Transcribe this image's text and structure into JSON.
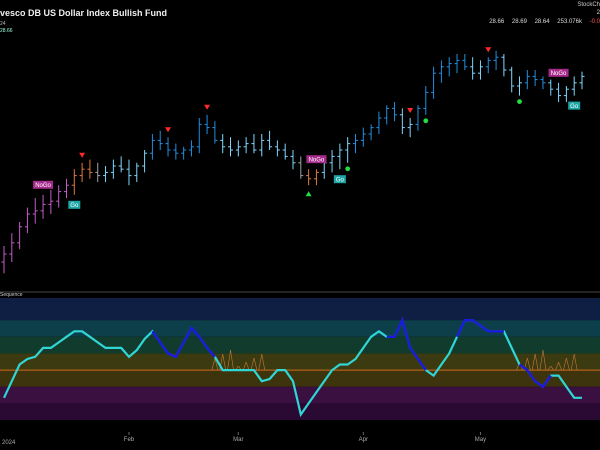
{
  "header": {
    "title": "vesco DB US Dollar Index Bullish Fund",
    "subtitle": "24",
    "last_price": "28.66",
    "brand": "StockCh",
    "year_tag": "2",
    "ohlc": [
      "28.66",
      "28.69",
      "28.64",
      "253.076k",
      "-0.0"
    ]
  },
  "oscillator_label": "Sequence",
  "year_label": "2024",
  "colors": {
    "background": "#000000",
    "go_strong": "#1f8fe0",
    "go_weak": "#7fd7ff",
    "nogo_weak": "#e07a3c",
    "nogo_strong": "#c35bc8",
    "neutral": "#9ea3a8",
    "osc_line_up": "#30d6d6",
    "osc_line_strong": "#1a1adc",
    "zero_line": "#d2691e",
    "go_label_bg": "#1ea5a5",
    "nogo_label_bg": "#a52a8c",
    "signal_green": "#22dd44",
    "signal_red": "#ff2a2a"
  },
  "chart_data": [
    {
      "type": "candlestick",
      "title": "vesco DB US Dollar Index Bullish Fund",
      "x_ticks": [
        "Feb",
        "Mar",
        "Apr",
        "May"
      ],
      "ylim": [
        27.35,
        28.95
      ],
      "bars": [
        {
          "o": 27.5,
          "h": 27.6,
          "l": 27.43,
          "c": 27.55,
          "s": "nogo_strong"
        },
        {
          "o": 27.55,
          "h": 27.68,
          "l": 27.5,
          "c": 27.62,
          "s": "nogo_strong"
        },
        {
          "o": 27.62,
          "h": 27.75,
          "l": 27.58,
          "c": 27.72,
          "s": "nogo_strong"
        },
        {
          "o": 27.72,
          "h": 27.84,
          "l": 27.68,
          "c": 27.8,
          "s": "nogo_strong"
        },
        {
          "o": 27.8,
          "h": 27.9,
          "l": 27.74,
          "c": 27.82,
          "s": "nogo_strong"
        },
        {
          "o": 27.82,
          "h": 27.92,
          "l": 27.77,
          "c": 27.86,
          "s": "nogo_strong"
        },
        {
          "o": 27.86,
          "h": 27.95,
          "l": 27.8,
          "c": 27.88,
          "s": "nogo_strong"
        },
        {
          "o": 27.88,
          "h": 27.98,
          "l": 27.84,
          "c": 27.94,
          "s": "nogo_strong"
        },
        {
          "o": 27.94,
          "h": 28.02,
          "l": 27.9,
          "c": 27.98,
          "s": "nogo_strong"
        },
        {
          "o": 27.98,
          "h": 28.08,
          "l": 27.92,
          "c": 28.04,
          "s": "nogo_weak"
        },
        {
          "o": 28.04,
          "h": 28.12,
          "l": 28.0,
          "c": 28.08,
          "s": "nogo_weak"
        },
        {
          "o": 28.08,
          "h": 28.14,
          "l": 28.02,
          "c": 28.06,
          "s": "nogo_weak"
        },
        {
          "o": 28.06,
          "h": 28.12,
          "l": 28.0,
          "c": 28.04,
          "s": "neutral"
        },
        {
          "o": 28.04,
          "h": 28.1,
          "l": 28.0,
          "c": 28.06,
          "s": "go_weak"
        },
        {
          "o": 28.06,
          "h": 28.14,
          "l": 28.02,
          "c": 28.1,
          "s": "go_weak"
        },
        {
          "o": 28.1,
          "h": 28.16,
          "l": 28.06,
          "c": 28.08,
          "s": "go_weak"
        },
        {
          "o": 28.08,
          "h": 28.14,
          "l": 27.98,
          "c": 28.04,
          "s": "go_weak"
        },
        {
          "o": 28.04,
          "h": 28.12,
          "l": 28.0,
          "c": 28.1,
          "s": "go_weak"
        },
        {
          "o": 28.1,
          "h": 28.2,
          "l": 28.06,
          "c": 28.18,
          "s": "go_weak"
        },
        {
          "o": 28.18,
          "h": 28.3,
          "l": 28.14,
          "c": 28.26,
          "s": "go_strong"
        },
        {
          "o": 28.26,
          "h": 28.32,
          "l": 28.2,
          "c": 28.24,
          "s": "go_strong"
        },
        {
          "o": 28.24,
          "h": 28.28,
          "l": 28.16,
          "c": 28.2,
          "s": "go_strong"
        },
        {
          "o": 28.2,
          "h": 28.24,
          "l": 28.14,
          "c": 28.18,
          "s": "go_strong"
        },
        {
          "o": 28.18,
          "h": 28.22,
          "l": 28.14,
          "c": 28.2,
          "s": "go_strong"
        },
        {
          "o": 28.2,
          "h": 28.26,
          "l": 28.16,
          "c": 28.22,
          "s": "go_strong"
        },
        {
          "o": 28.22,
          "h": 28.4,
          "l": 28.18,
          "c": 28.36,
          "s": "go_strong"
        },
        {
          "o": 28.36,
          "h": 28.42,
          "l": 28.3,
          "c": 28.34,
          "s": "go_strong"
        },
        {
          "o": 28.34,
          "h": 28.38,
          "l": 28.24,
          "c": 28.26,
          "s": "go_strong"
        },
        {
          "o": 28.26,
          "h": 28.3,
          "l": 28.18,
          "c": 28.22,
          "s": "go_weak"
        },
        {
          "o": 28.22,
          "h": 28.28,
          "l": 28.16,
          "c": 28.2,
          "s": "go_weak"
        },
        {
          "o": 28.2,
          "h": 28.26,
          "l": 28.16,
          "c": 28.22,
          "s": "go_weak"
        },
        {
          "o": 28.22,
          "h": 28.28,
          "l": 28.18,
          "c": 28.24,
          "s": "go_weak"
        },
        {
          "o": 28.24,
          "h": 28.3,
          "l": 28.18,
          "c": 28.2,
          "s": "go_weak"
        },
        {
          "o": 28.2,
          "h": 28.3,
          "l": 28.16,
          "c": 28.26,
          "s": "go_weak"
        },
        {
          "o": 28.26,
          "h": 28.32,
          "l": 28.2,
          "c": 28.22,
          "s": "go_weak"
        },
        {
          "o": 28.22,
          "h": 28.26,
          "l": 28.16,
          "c": 28.2,
          "s": "go_weak"
        },
        {
          "o": 28.2,
          "h": 28.24,
          "l": 28.14,
          "c": 28.16,
          "s": "go_weak"
        },
        {
          "o": 28.16,
          "h": 28.2,
          "l": 28.08,
          "c": 28.12,
          "s": "go_weak"
        },
        {
          "o": 28.12,
          "h": 28.16,
          "l": 28.02,
          "c": 28.04,
          "s": "neutral"
        },
        {
          "o": 28.04,
          "h": 28.08,
          "l": 27.98,
          "c": 28.02,
          "s": "nogo_weak"
        },
        {
          "o": 28.02,
          "h": 28.08,
          "l": 27.98,
          "c": 28.06,
          "s": "nogo_weak"
        },
        {
          "o": 28.06,
          "h": 28.14,
          "l": 28.02,
          "c": 28.12,
          "s": "go_weak"
        },
        {
          "o": 28.12,
          "h": 28.2,
          "l": 28.06,
          "c": 28.16,
          "s": "go_weak"
        },
        {
          "o": 28.16,
          "h": 28.24,
          "l": 28.08,
          "c": 28.2,
          "s": "go_weak"
        },
        {
          "o": 28.2,
          "h": 28.28,
          "l": 28.12,
          "c": 28.24,
          "s": "go_weak"
        },
        {
          "o": 28.24,
          "h": 28.3,
          "l": 28.18,
          "c": 28.26,
          "s": "go_strong"
        },
        {
          "o": 28.26,
          "h": 28.34,
          "l": 28.22,
          "c": 28.3,
          "s": "go_strong"
        },
        {
          "o": 28.3,
          "h": 28.36,
          "l": 28.26,
          "c": 28.34,
          "s": "go_strong"
        },
        {
          "o": 28.34,
          "h": 28.44,
          "l": 28.3,
          "c": 28.4,
          "s": "go_strong"
        },
        {
          "o": 28.4,
          "h": 28.48,
          "l": 28.36,
          "c": 28.46,
          "s": "go_strong"
        },
        {
          "o": 28.46,
          "h": 28.5,
          "l": 28.38,
          "c": 28.42,
          "s": "go_strong"
        },
        {
          "o": 28.42,
          "h": 28.46,
          "l": 28.3,
          "c": 28.34,
          "s": "go_weak"
        },
        {
          "o": 28.34,
          "h": 28.4,
          "l": 28.28,
          "c": 28.36,
          "s": "go_weak"
        },
        {
          "o": 28.36,
          "h": 28.48,
          "l": 28.32,
          "c": 28.46,
          "s": "go_strong"
        },
        {
          "o": 28.46,
          "h": 28.6,
          "l": 28.42,
          "c": 28.56,
          "s": "go_strong"
        },
        {
          "o": 28.56,
          "h": 28.72,
          "l": 28.52,
          "c": 28.68,
          "s": "go_strong"
        },
        {
          "o": 28.68,
          "h": 28.76,
          "l": 28.62,
          "c": 28.72,
          "s": "go_strong"
        },
        {
          "o": 28.72,
          "h": 28.78,
          "l": 28.66,
          "c": 28.74,
          "s": "go_strong"
        },
        {
          "o": 28.74,
          "h": 28.8,
          "l": 28.68,
          "c": 28.76,
          "s": "go_strong"
        },
        {
          "o": 28.76,
          "h": 28.8,
          "l": 28.7,
          "c": 28.72,
          "s": "go_strong"
        },
        {
          "o": 28.72,
          "h": 28.78,
          "l": 28.64,
          "c": 28.68,
          "s": "go_weak"
        },
        {
          "o": 28.68,
          "h": 28.76,
          "l": 28.64,
          "c": 28.72,
          "s": "go_weak"
        },
        {
          "o": 28.72,
          "h": 28.78,
          "l": 28.68,
          "c": 28.76,
          "s": "go_strong"
        },
        {
          "o": 28.76,
          "h": 28.82,
          "l": 28.7,
          "c": 28.78,
          "s": "go_strong"
        },
        {
          "o": 28.78,
          "h": 28.8,
          "l": 28.66,
          "c": 28.7,
          "s": "go_weak"
        },
        {
          "o": 28.7,
          "h": 28.72,
          "l": 28.56,
          "c": 28.6,
          "s": "go_weak"
        },
        {
          "o": 28.6,
          "h": 28.66,
          "l": 28.54,
          "c": 28.62,
          "s": "go_weak"
        },
        {
          "o": 28.62,
          "h": 28.7,
          "l": 28.58,
          "c": 28.66,
          "s": "go_strong"
        },
        {
          "o": 28.66,
          "h": 28.7,
          "l": 28.6,
          "c": 28.64,
          "s": "go_strong"
        },
        {
          "o": 28.64,
          "h": 28.66,
          "l": 28.58,
          "c": 28.62,
          "s": "go_strong"
        },
        {
          "o": 28.62,
          "h": 28.64,
          "l": 28.54,
          "c": 28.58,
          "s": "go_weak"
        },
        {
          "o": 28.58,
          "h": 28.62,
          "l": 28.5,
          "c": 28.54,
          "s": "go_weak"
        },
        {
          "o": 28.54,
          "h": 28.6,
          "l": 28.5,
          "c": 28.58,
          "s": "go_weak"
        },
        {
          "o": 28.58,
          "h": 28.66,
          "l": 28.54,
          "c": 28.62,
          "s": "go_weak"
        },
        {
          "o": 28.62,
          "h": 28.69,
          "l": 28.58,
          "c": 28.66,
          "s": "go_weak"
        }
      ],
      "markers": [
        {
          "i": 10,
          "kind": "down"
        },
        {
          "i": 21,
          "kind": "down"
        },
        {
          "i": 26,
          "kind": "down"
        },
        {
          "i": 39,
          "kind": "up"
        },
        {
          "i": 44,
          "kind": "dot"
        },
        {
          "i": 52,
          "kind": "down"
        },
        {
          "i": 54,
          "kind": "dot"
        },
        {
          "i": 62,
          "kind": "down"
        },
        {
          "i": 66,
          "kind": "dot"
        }
      ],
      "labels": [
        {
          "i": 5,
          "text": "NoGo",
          "kind": "nogo",
          "at": "high"
        },
        {
          "i": 9,
          "text": "Go",
          "kind": "go",
          "at": "low"
        },
        {
          "i": 40,
          "text": "NoGo",
          "kind": "nogo",
          "at": "high"
        },
        {
          "i": 43,
          "text": "Go",
          "kind": "go",
          "at": "low"
        },
        {
          "i": 71,
          "text": "NoGo",
          "kind": "nogo",
          "at": "high"
        },
        {
          "i": 73,
          "text": "Go",
          "kind": "go",
          "at": "low"
        }
      ]
    },
    {
      "type": "line",
      "name": "Sequence",
      "ylim": [
        -4.5,
        6.5
      ],
      "zero": 0,
      "bands": [
        {
          "from": 4.5,
          "to": 6.5,
          "color": "#0f1f44"
        },
        {
          "from": 3,
          "to": 4.5,
          "color": "#0d3f4a"
        },
        {
          "from": 1.5,
          "to": 3,
          "color": "#113b2c"
        },
        {
          "from": 0,
          "to": 1.5,
          "color": "#3b3a10"
        },
        {
          "from": -1.5,
          "to": 0,
          "color": "#3d330c"
        },
        {
          "from": -3,
          "to": -1.5,
          "color": "#3a1040"
        },
        {
          "from": -4.5,
          "to": -3,
          "color": "#2a0a32"
        }
      ],
      "values": [
        -2.5,
        -1.0,
        0.5,
        1.0,
        1.2,
        2.0,
        2.0,
        2.5,
        3.0,
        3.5,
        3.5,
        3.0,
        2.5,
        2.0,
        2.0,
        2.0,
        1.2,
        1.8,
        2.8,
        3.5,
        2.5,
        1.5,
        1.2,
        2.5,
        3.8,
        3.0,
        2.0,
        1.2,
        0.0,
        0.0,
        0.0,
        0.0,
        0.0,
        -1.0,
        -0.8,
        0.0,
        0.0,
        -1.0,
        -4.0,
        -3.0,
        -2.0,
        -1.0,
        0.0,
        0.5,
        0.5,
        1.0,
        2.0,
        3.0,
        3.5,
        3.0,
        3.0,
        4.5,
        2.0,
        1.0,
        0.0,
        -0.5,
        0.5,
        1.5,
        3.0,
        4.5,
        4.5,
        4.0,
        3.5,
        3.5,
        3.5,
        2.0,
        0.5,
        0.0,
        -1.0,
        -1.5,
        -0.5,
        -0.5,
        -1.5,
        -2.5,
        -2.5
      ],
      "strong_segments": [
        [
          19,
          27
        ],
        [
          49,
          54
        ],
        [
          58,
          64
        ],
        [
          66,
          70
        ]
      ],
      "wick_indices": [
        27,
        28,
        29,
        30,
        31,
        32,
        33,
        66,
        67,
        68,
        69,
        70,
        71,
        72,
        73
      ]
    }
  ]
}
